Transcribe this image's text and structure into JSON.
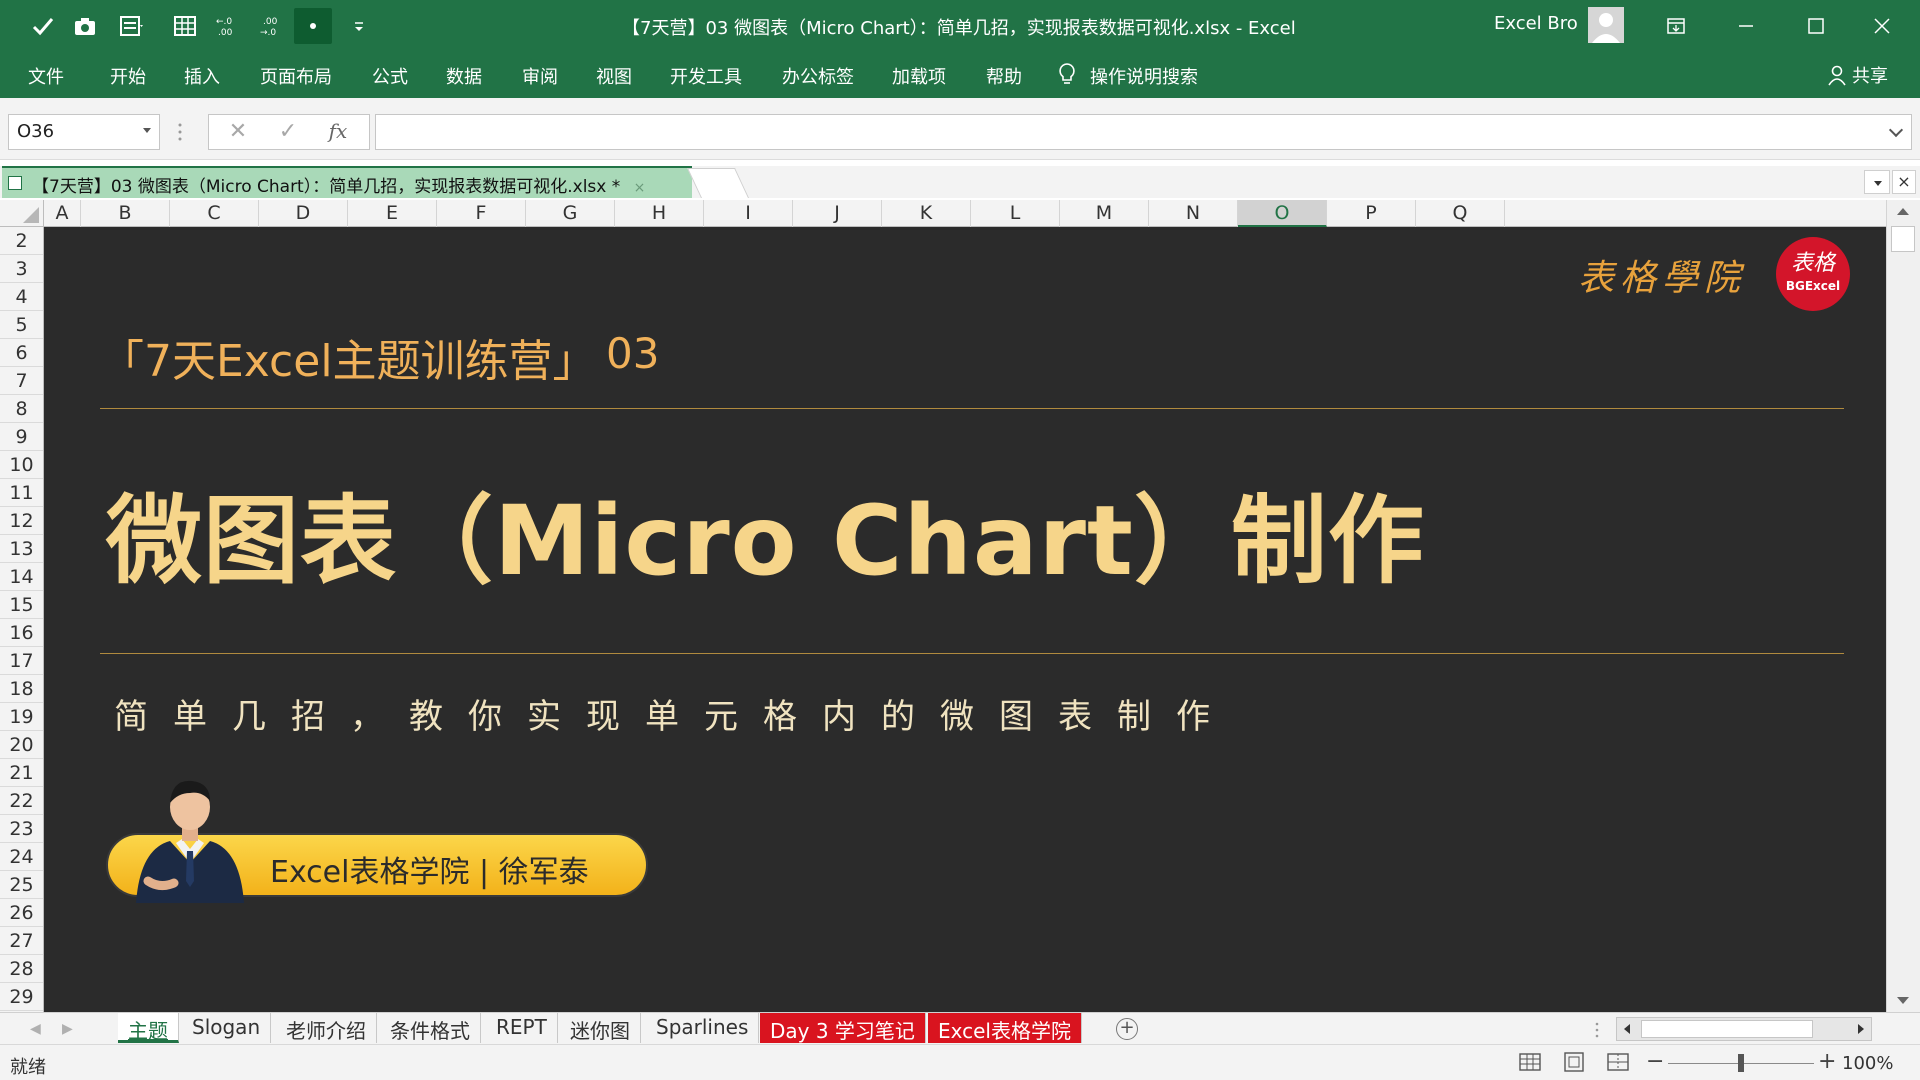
{
  "window": {
    "title": "【7天营】03 微图表（Micro Chart）：简单几招，实现报表数据可视化.xlsx  -  Excel",
    "user_name": "Excel Bro"
  },
  "ribbon": {
    "tabs": [
      "文件",
      "开始",
      "插入",
      "页面布局",
      "公式",
      "数据",
      "审阅",
      "视图",
      "开发工具",
      "办公标签",
      "加载项",
      "帮助"
    ],
    "tell_me": "操作说明搜索",
    "share": "共享"
  },
  "formula_bar": {
    "name_box": "O36",
    "formula": "",
    "fx_label": "fx"
  },
  "workbook_tab": {
    "label": "【7天营】03 微图表（Micro Chart）：简单几招，实现报表数据可视化.xlsx *",
    "close": "×"
  },
  "grid": {
    "columns": [
      "A",
      "B",
      "C",
      "D",
      "E",
      "F",
      "G",
      "H",
      "I",
      "J",
      "K",
      "L",
      "M",
      "N",
      "O",
      "P",
      "Q"
    ],
    "selected_column": "O",
    "rows": [
      "2",
      "3",
      "4",
      "5",
      "6",
      "7",
      "8",
      "9",
      "10",
      "11",
      "12",
      "13",
      "14",
      "15",
      "16",
      "17",
      "18",
      "19",
      "20",
      "21",
      "22",
      "23",
      "24",
      "25",
      "26",
      "27",
      "28",
      "29"
    ]
  },
  "slide": {
    "logo_text": "表格學院",
    "logo_seal_text": "表格",
    "logo_seal_sub": "BGExcel",
    "camp_title": "「7天Excel主题训练营」",
    "camp_number": "03",
    "main_title": "微图表（Micro Chart）制作",
    "subtitle": "简单几招，教你实现单元格内的微图表制作",
    "host_label": "Excel表格学院 | 徐军泰"
  },
  "sheet_tabs": [
    {
      "label": "主题",
      "state": "active"
    },
    {
      "label": "Slogan",
      "state": "normal"
    },
    {
      "label": "老师介绍",
      "state": "normal"
    },
    {
      "label": "条件格式",
      "state": "normal"
    },
    {
      "label": "REPT",
      "state": "normal"
    },
    {
      "label": "迷你图",
      "state": "normal"
    },
    {
      "label": "Sparlines",
      "state": "normal"
    },
    {
      "label": "Day 3 学习笔记",
      "state": "red"
    },
    {
      "label": "Excel表格学院",
      "state": "red"
    }
  ],
  "status": {
    "text": "就绪",
    "zoom": "100%",
    "zoom_fraction": 0.5
  },
  "colors": {
    "excel_green": "#217346",
    "slide_background": "#2b2b2b",
    "gold": "#f6d58a",
    "red_tab": "#d9141f"
  }
}
